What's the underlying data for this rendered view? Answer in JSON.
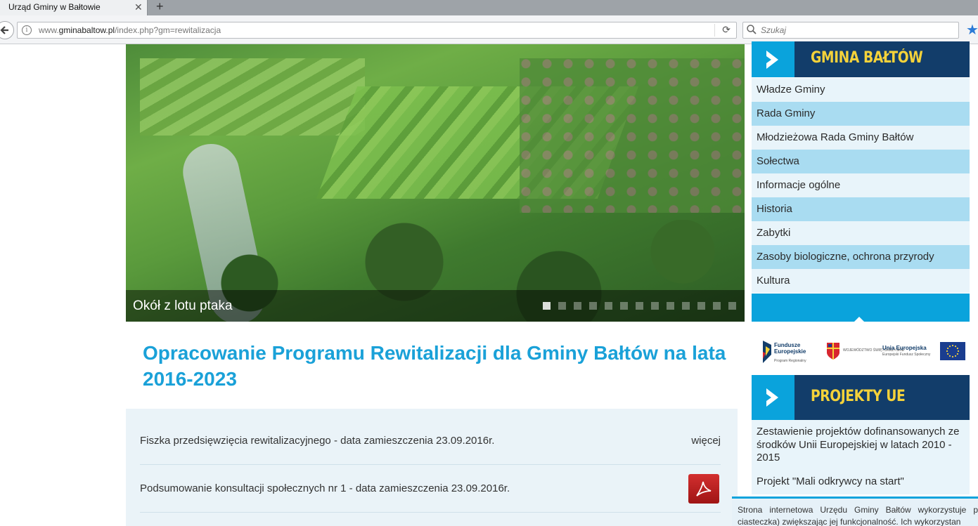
{
  "browser": {
    "tab_title": "Urząd Gminy w Bałtowie",
    "tab_close": "✕",
    "new_tab": "+",
    "url_prefix": "www.",
    "url_domain": "gminabaltow.pl",
    "url_path": "/index.php?gm=rewitalizacja",
    "search_placeholder": "Szukaj"
  },
  "hero": {
    "caption": "Okół z lotu ptaka",
    "slide_count": 13,
    "active_slide": 1
  },
  "article": {
    "title": "Opracowanie Programu Rewitalizacji dla Gminy Bałtów na lata 2016-2023",
    "documents": [
      {
        "text": "Fiszka przedsięwzięcia rewitalizacyjnego - data zamieszczenia 23.09.2016r.",
        "action": "więcej"
      },
      {
        "text": "Podsumowanie konsultacji społecznych nr 1 - data zamieszczenia 23.09.2016r.",
        "action_icon": "pdf-icon"
      }
    ]
  },
  "sidebar": {
    "gmina_header": "GMINA BAŁTÓW",
    "menu": [
      "Władze Gminy",
      "Rada Gminy",
      "Młodzieżowa Rada Gminy Bałtów",
      "Sołectwa",
      "Informacje ogólne",
      "Historia",
      "Zabytki",
      "Zasoby biologiczne, ochrona przyrody",
      "Kultura"
    ],
    "logos": {
      "fe_name": "Fundusze Europejskie",
      "fe_sub": "Program Regionalny",
      "sw_name": "WOJEWÓDZTWO ŚWIĘTOKRZYSKIE",
      "ue_name": "Unia Europejska",
      "ue_sub": "Europejski Fundusz Społeczny"
    },
    "projects_header": "PROJEKTY UE",
    "projects": [
      "Zestawienie projektów dofinansowanych ze środków Unii Europejskiej w latach 2010 - 2015",
      "Projekt \"Mali odkrywcy na start\""
    ]
  },
  "cookie": {
    "text": "Strona internetowa Urzędu Gminy Bałtów wykorzystuje p ciasteczka) zwiększając jej funkcjonalność. Ich wykorzystan"
  },
  "colors": {
    "accent": "#1aa1d8",
    "header_dark": "#123d6a",
    "header_text": "#f4d23a",
    "menu_light": "#e8f4fa",
    "menu_alt": "#a9dcf1"
  }
}
